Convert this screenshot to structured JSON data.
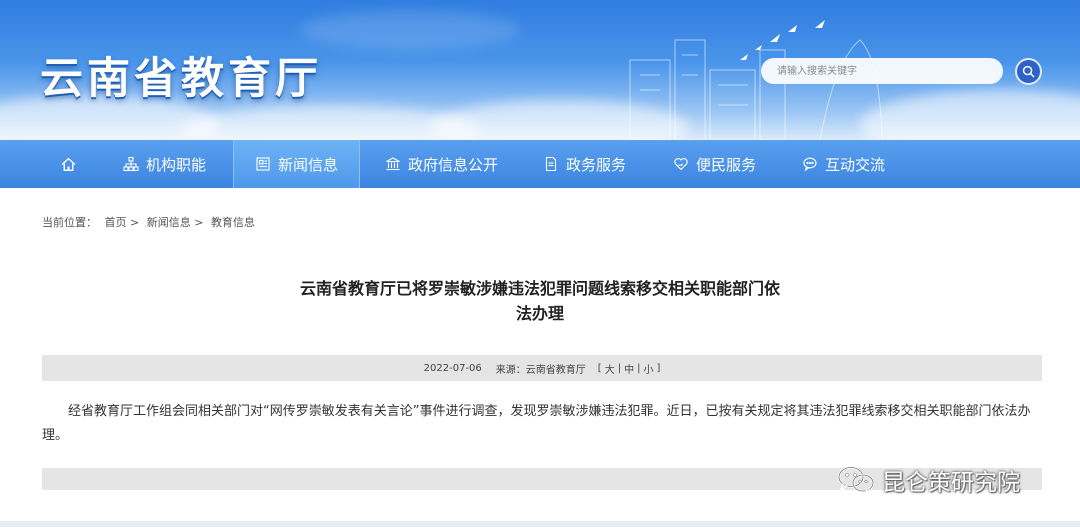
{
  "header": {
    "site_title": "云南省教育厅",
    "search_placeholder": "请输入搜索关键字"
  },
  "nav": {
    "items": [
      {
        "label": "",
        "icon": "home-icon"
      },
      {
        "label": "机构职能",
        "icon": "org-chart-icon"
      },
      {
        "label": "新闻信息",
        "icon": "newspaper-icon",
        "active": true
      },
      {
        "label": "政府信息公开",
        "icon": "government-building-icon"
      },
      {
        "label": "政务服务",
        "icon": "document-icon"
      },
      {
        "label": "便民服务",
        "icon": "heart-hands-icon"
      },
      {
        "label": "互动交流",
        "icon": "chat-bubble-icon"
      }
    ]
  },
  "breadcrumb": {
    "prefix": "当前位置：",
    "items": [
      "首页",
      "新闻信息",
      "教育信息"
    ],
    "separator": ">"
  },
  "article": {
    "title_line1": "云南省教育厅已将罗崇敏涉嫌违法犯罪问题线索移交相关职能部门依",
    "title_line2": "法办理",
    "date": "2022-07-06",
    "source_label": "来源：",
    "source": "云南省教育厅",
    "font_size_open": "[",
    "font_size_large": "大",
    "font_size_medium": "中",
    "font_size_small": "小",
    "font_size_close": "]",
    "font_size_sep": "|",
    "body": "经省教育厅工作组会同相关部门对“网传罗崇敏发表有关言论”事件进行调查，发现罗崇敏涉嫌违法犯罪。近日，已按有关规定将其违法犯罪线索移交相关职能部门依法办理。"
  },
  "watermark": {
    "text": "昆仑策研究院"
  },
  "colors": {
    "nav_bg": "#3b84e0",
    "nav_active": "#5fa6f2",
    "search_button": "#2e62c9",
    "meta_bar": "#e5e5e5"
  }
}
